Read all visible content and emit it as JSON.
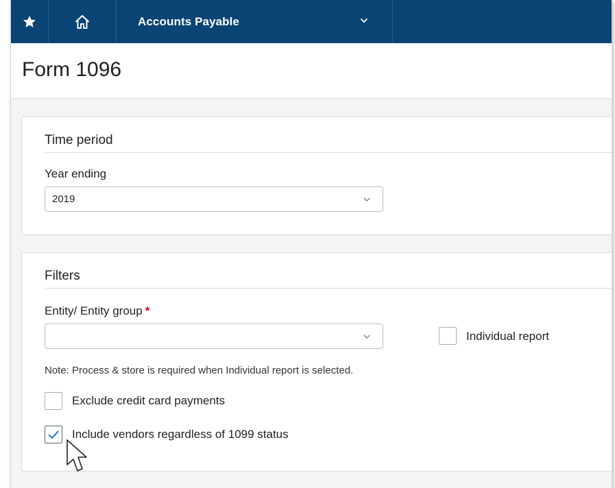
{
  "header": {
    "module_label": "Accounts Payable",
    "icons": [
      "star-icon",
      "home-icon",
      "chevron-down-icon"
    ],
    "colors": {
      "bar": "#0a4474",
      "text": "#ffffff"
    }
  },
  "page": {
    "title": "Form 1096"
  },
  "time_period": {
    "title": "Time period",
    "year_label": "Year ending",
    "year_value": "2019"
  },
  "filters": {
    "title": "Filters",
    "entity_label": "Entity/ Entity group",
    "entity_required_mark": "*",
    "entity_value": "",
    "individual_report_label": "Individual report",
    "individual_report_checked": false,
    "note": "Note: Process & store is required when Individual report is selected.",
    "exclude_cc_label": "Exclude credit card payments",
    "exclude_cc_checked": false,
    "include_vendors_label": "Include vendors regardless of 1099 status",
    "include_vendors_checked": true
  },
  "colors": {
    "page_bg": "#f3f4f5",
    "required": "#d0021b",
    "check": "#1a73c8"
  }
}
